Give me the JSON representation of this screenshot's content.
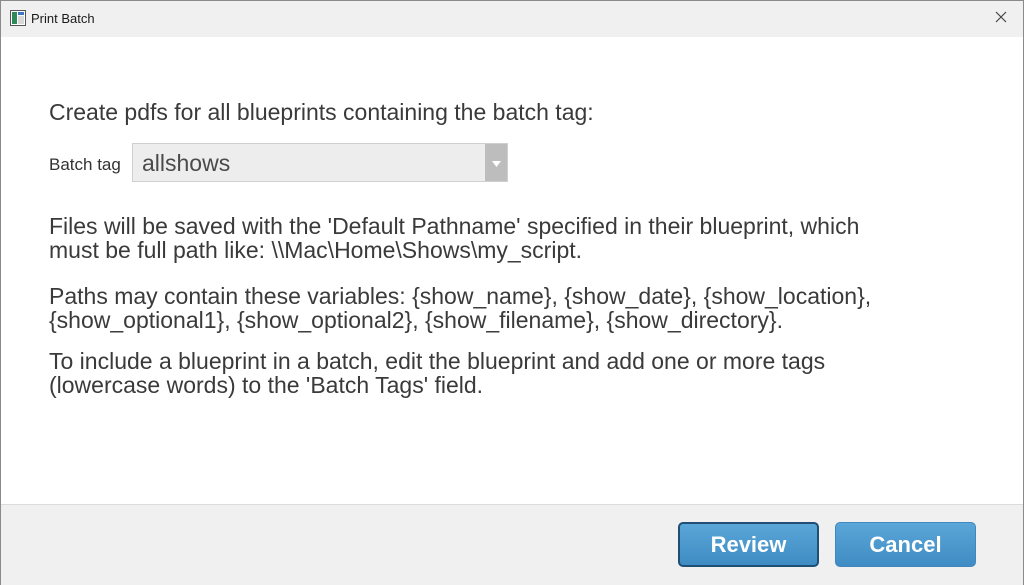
{
  "window": {
    "title": "Print Batch",
    "icons": {
      "app": "app-window-icon",
      "close": "close-icon"
    }
  },
  "main": {
    "intro": "Create pdfs for all blueprints containing the batch tag:",
    "batch_tag": {
      "label": "Batch tag",
      "value": "allshows"
    },
    "paragraphs": [
      {
        "lines": [
          "Files will be saved with the 'Default Pathname' specified in their blueprint, which",
          "must be full path like: \\\\Mac\\Home\\Shows\\my_script."
        ]
      },
      {
        "lines": [
          "Paths may contain these variables: {show_name}, {show_date}, {show_location},",
          "{show_optional1}, {show_optional2}, {show_filename}, {show_directory}."
        ]
      },
      {
        "lines": [
          "To include a blueprint in a batch, edit the blueprint and add one or more tags",
          "(lowercase words) to the 'Batch Tags' field."
        ]
      }
    ]
  },
  "footer": {
    "review_label": "Review",
    "cancel_label": "Cancel"
  },
  "colors": {
    "button_fill": "#4a98cf",
    "default_button_border": "#1f4f74",
    "titlebar": "#f0f0f0",
    "footer": "#f0f0f0"
  }
}
